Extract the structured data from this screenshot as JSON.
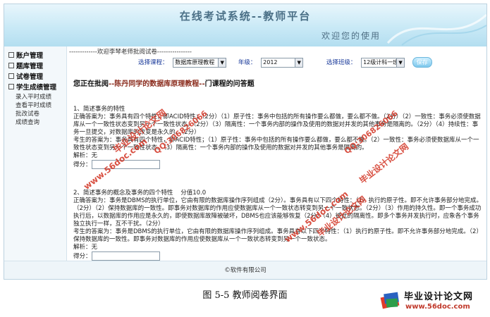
{
  "header": {
    "title": "在线考试系统--教师平台",
    "welcome": "欢迎您的使用"
  },
  "sidebar": {
    "groups": [
      {
        "label": "账户管理",
        "items": []
      },
      {
        "label": "题库管理",
        "items": []
      },
      {
        "label": "试卷管理",
        "items": []
      },
      {
        "label": "学生成绩管理",
        "items": [
          "录入平时成绩",
          "查看平时成绩",
          "批改试卷",
          "成绩查询"
        ]
      }
    ]
  },
  "main": {
    "notice": "-------------欢迎李琴老师批阅试卷----------------",
    "filters": {
      "course_label": "选择课程：",
      "course_value": "数据库原理教程",
      "grade_label": "年级：",
      "grade_value": "2012",
      "class_label": "选择班级：",
      "class_value": "12级计科一班",
      "save_label": "保存"
    },
    "heading": {
      "prefix": "您正在批阅",
      "highlight": "--陈丹同学的数据库原理教程--",
      "suffix": "门课程的问答题"
    },
    "questions": [
      {
        "title": "1、简述事务的特性",
        "answer_label": "正确答案为：",
        "answer": "事务具有四个特性，即ACID特性；（2分）（1）原子性：事务中包括的所有操作要么都做，要么都不做。（2分）（2）一致性：事务必须使数据库从一个一致性状态变到另一个一致性状态。（2分）（3）隔离性：一个事务内部的操作及使用的数据对并发的其他事务是隔离的。（2分）（4）持续性：事务一旦提交，对数据库的改变是永久的。（2分）",
        "student_label": "考生的答案为：",
        "student_answer": "事务具有四个特性，即ACID特性；（1）原子性：事务中包括的所有操作要么都做，要么都不做。（2）一致性：事务必须使数据库从一个一致性状态变到另一个一致性状态。（3）隔离性：一个事务内部的操作及使用的数据对并发的其他事务是隔离的。",
        "analysis_label": "解析：",
        "analysis": "无",
        "score_label": "得分："
      },
      {
        "title": "2、简述事务的概念及事务的四个特性",
        "score_note": "分值10.0",
        "answer_label": "正确答案为：",
        "answer": "事务是DBMS的执行单位，它由有限的数据库操作序列组成（2分）。事务具有以下四个特性：（1）执行的原子性。即不允许事务部分地完成。（2分）（2）保持数据库的一致性。即事务对数据库的作用应使数据库从一个一致状态转变到另一个一致状态。（2分）（3）作用的持久性。即一个事务成功执行后，以数据库的作用应是永久的，即使数据库故障被破坏，DBMS也应该能够恢复（2分）（4）彼此的隔离性。即多个事务并发执行时，应象各个事务独立执行一样，互不干扰。（2分）",
        "student_label": "考生的答案为：",
        "student_answer": "事务是DBMS的执行单位，它由有限的数据库操作序列组成。事务具有以下四个特性：（1）执行的原子性。即不允许事务部分地完成。（2）保持数据库的一致性。即事务对数据库的作用应使数据库从一个一致状态转变到另一个一致状态。",
        "analysis_label": "解析：",
        "analysis": "无",
        "score_label": "得分："
      }
    ]
  },
  "footer": {
    "text": "©软件有限公司"
  },
  "caption": {
    "text": "图 5-5  教师阅卷界面"
  },
  "logo": {
    "title": "毕业设计论文网",
    "url": "www.56doc.com"
  },
  "watermarks": {
    "site": "毕业设计论文网",
    "url": "www.56doc.com",
    "qq": "QQ:306826066"
  }
}
